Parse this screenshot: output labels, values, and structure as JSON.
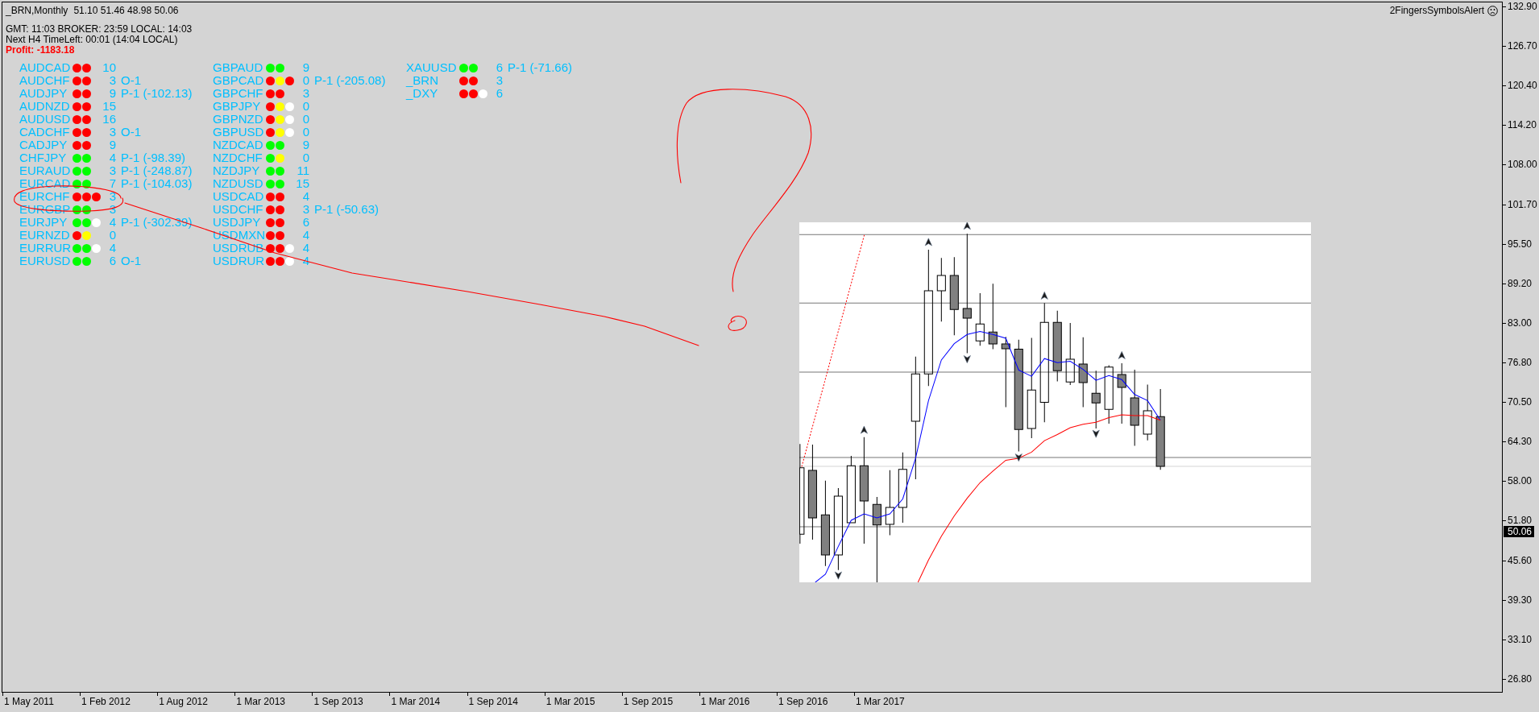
{
  "chart_header": {
    "title": "_BRN,Monthly",
    "ohlc": "51.10 51.46 48.98 50.06"
  },
  "clock": {
    "times": "GMT: 11:03 BROKER: 23:59 LOCAL: 14:03",
    "next_bar": "Next H4 TimeLeft: 00:01 (14:04 LOCAL)",
    "profit": "Profit: -1183.18"
  },
  "indicator": {
    "name": "2FingersSymbolsAlert"
  },
  "symbol_columns": [
    {
      "rows": [
        {
          "symbol": "AUDCAD",
          "dots": [
            {
              "color": "#ff0000"
            },
            {
              "color": "#ff0000"
            }
          ],
          "count": "10"
        },
        {
          "symbol": "AUDCHF",
          "dots": [
            {
              "color": "#ff0000"
            },
            {
              "color": "#ff0000"
            }
          ],
          "count": "3",
          "signal": "O-1"
        },
        {
          "symbol": "AUDJPY",
          "dots": [
            {
              "color": "#ff0000"
            },
            {
              "color": "#ff0000"
            }
          ],
          "count": "9",
          "signal": "P-1 (-102.13)"
        },
        {
          "symbol": "AUDNZD",
          "dots": [
            {
              "color": "#ff0000"
            },
            {
              "color": "#ff0000"
            }
          ],
          "count": "15"
        },
        {
          "symbol": "AUDUSD",
          "dots": [
            {
              "color": "#ff0000"
            },
            {
              "color": "#ff0000"
            }
          ],
          "count": "16"
        },
        {
          "symbol": "CADCHF",
          "dots": [
            {
              "color": "#ff0000"
            },
            {
              "color": "#ff0000"
            }
          ],
          "count": "3",
          "signal": "O-1"
        },
        {
          "symbol": "CADJPY",
          "dots": [
            {
              "color": "#ff0000"
            },
            {
              "color": "#ff0000"
            }
          ],
          "count": "9"
        },
        {
          "symbol": "CHFJPY",
          "dots": [
            {
              "color": "#00ff00"
            },
            {
              "color": "#00ff00"
            }
          ],
          "count": "4",
          "signal": "P-1 (-98.39)"
        },
        {
          "symbol": "EURAUD",
          "dots": [
            {
              "color": "#00ff00"
            },
            {
              "color": "#00ff00"
            }
          ],
          "count": "3",
          "signal": "P-1 (-248.87)"
        },
        {
          "symbol": "EURCAD",
          "dots": [
            {
              "color": "#00ff00"
            },
            {
              "color": "#00ff00"
            }
          ],
          "count": "7",
          "signal": "P-1 (-104.03)"
        },
        {
          "symbol": "EURCHF",
          "dots": [
            {
              "color": "#ff0000"
            },
            {
              "color": "#ff0000"
            },
            {
              "color": "#ff0000"
            }
          ],
          "count": "3"
        },
        {
          "symbol": "EURGBP",
          "dots": [
            {
              "color": "#00ff00"
            },
            {
              "color": "#00ff00"
            }
          ],
          "count": "3"
        },
        {
          "symbol": "EURJPY",
          "dots": [
            {
              "color": "#00ff00"
            },
            {
              "color": "#00ff00"
            },
            {
              "color": "#ffffff"
            }
          ],
          "count": "4",
          "signal": "P-1 (-302.39)"
        },
        {
          "symbol": "EURNZD",
          "dots": [
            {
              "color": "#ff0000"
            },
            {
              "color": "#ffff00"
            }
          ],
          "count": "0"
        },
        {
          "symbol": "EURRUR",
          "dots": [
            {
              "color": "#00ff00"
            },
            {
              "color": "#00ff00"
            },
            {
              "color": "#ffffff"
            }
          ],
          "count": "4"
        },
        {
          "symbol": "EURUSD",
          "dots": [
            {
              "color": "#00ff00"
            },
            {
              "color": "#00ff00"
            }
          ],
          "count": "6",
          "signal": "O-1"
        }
      ]
    },
    {
      "rows": [
        {
          "symbol": "GBPAUD",
          "dots": [
            {
              "color": "#00ff00"
            },
            {
              "color": "#00ff00"
            }
          ],
          "count": "9"
        },
        {
          "symbol": "GBPCAD",
          "dots": [
            {
              "color": "#ff0000"
            },
            {
              "color": "#ffff00"
            },
            {
              "color": "#ff0000"
            }
          ],
          "count": "0",
          "signal": "P-1 (-205.08)"
        },
        {
          "symbol": "GBPCHF",
          "dots": [
            {
              "color": "#ff0000"
            },
            {
              "color": "#ff0000"
            }
          ],
          "count": "3"
        },
        {
          "symbol": "GBPJPY",
          "dots": [
            {
              "color": "#ff0000"
            },
            {
              "color": "#ffff00"
            },
            {
              "color": "#ffffff"
            }
          ],
          "count": "0"
        },
        {
          "symbol": "GBPNZD",
          "dots": [
            {
              "color": "#ff0000"
            },
            {
              "color": "#ffff00"
            },
            {
              "color": "#ffffff"
            }
          ],
          "count": "0"
        },
        {
          "symbol": "GBPUSD",
          "dots": [
            {
              "color": "#ff0000"
            },
            {
              "color": "#ffff00"
            },
            {
              "color": "#ffffff"
            }
          ],
          "count": "0"
        },
        {
          "symbol": "NZDCAD",
          "dots": [
            {
              "color": "#00ff00"
            },
            {
              "color": "#00ff00"
            }
          ],
          "count": "9"
        },
        {
          "symbol": "NZDCHF",
          "dots": [
            {
              "color": "#00ff00"
            },
            {
              "color": "#ffff00"
            }
          ],
          "count": "0"
        },
        {
          "symbol": "NZDJPY",
          "dots": [
            {
              "color": "#00ff00"
            },
            {
              "color": "#00ff00"
            }
          ],
          "count": "11"
        },
        {
          "symbol": "NZDUSD",
          "dots": [
            {
              "color": "#00ff00"
            },
            {
              "color": "#00ff00"
            }
          ],
          "count": "15"
        },
        {
          "symbol": "USDCAD",
          "dots": [
            {
              "color": "#ff0000"
            },
            {
              "color": "#ff0000"
            }
          ],
          "count": "4"
        },
        {
          "symbol": "USDCHF",
          "dots": [
            {
              "color": "#ff0000"
            },
            {
              "color": "#ff0000"
            }
          ],
          "count": "3",
          "signal": "P-1 (-50.63)"
        },
        {
          "symbol": "USDJPY",
          "dots": [
            {
              "color": "#ff0000"
            },
            {
              "color": "#ff0000"
            }
          ],
          "count": "6"
        },
        {
          "symbol": "USDMXN",
          "dots": [
            {
              "color": "#ff0000"
            },
            {
              "color": "#ff0000"
            }
          ],
          "count": "4"
        },
        {
          "symbol": "USDRUB",
          "dots": [
            {
              "color": "#ff0000"
            },
            {
              "color": "#ff0000"
            },
            {
              "color": "#ffffff"
            }
          ],
          "count": "4"
        },
        {
          "symbol": "USDRUR",
          "dots": [
            {
              "color": "#ff0000"
            },
            {
              "color": "#ff0000"
            },
            {
              "color": "#ffffff"
            }
          ],
          "count": "4"
        }
      ]
    },
    {
      "rows": [
        {
          "symbol": "XAUUSD",
          "dots": [
            {
              "color": "#00ff00"
            },
            {
              "color": "#00ff00"
            }
          ],
          "count": "6",
          "signal": "P-1 (-71.66)"
        },
        {
          "symbol": "_BRN",
          "dots": [
            {
              "color": "#ff0000"
            },
            {
              "color": "#ff0000"
            }
          ],
          "count": "3"
        },
        {
          "symbol": "_DXY",
          "dots": [
            {
              "color": "#ff0000"
            },
            {
              "color": "#ff0000"
            },
            {
              "color": "#ffffff"
            }
          ],
          "count": "6"
        }
      ]
    }
  ],
  "price_axis": {
    "labels": [
      "132.90",
      "126.70",
      "120.40",
      "114.20",
      "108.00",
      "101.70",
      "95.50",
      "89.20",
      "83.00",
      "76.80",
      "70.50",
      "64.30",
      "58.00",
      "51.80",
      "45.60",
      "39.30",
      "33.10",
      "26.80"
    ],
    "current_price": "50.06"
  },
  "time_axis": {
    "labels": [
      "1 May 2011",
      "1 Feb 2012",
      "1 Aug 2012",
      "1 Mar 2013",
      "1 Sep 2013",
      "1 Mar 2014",
      "1 Sep 2014",
      "1 Mar 2015",
      "1 Sep 2015",
      "1 Mar 2016",
      "1 Sep 2016",
      "1 Mar 2017"
    ]
  }
}
